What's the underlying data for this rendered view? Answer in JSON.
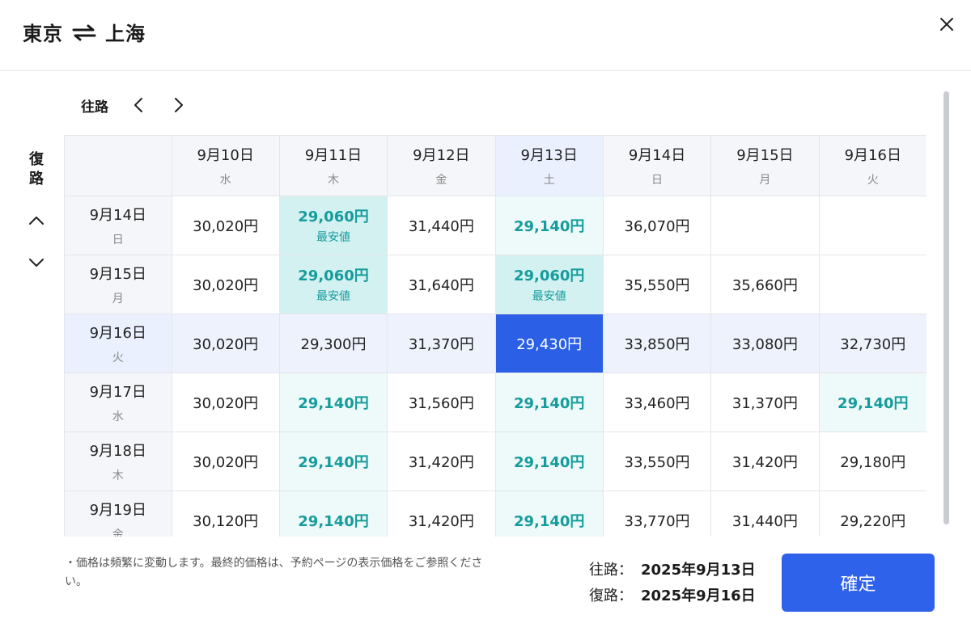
{
  "header": {
    "origin": "東京",
    "destination": "上海",
    "swap_icon": "swap-arrows-icon",
    "close_icon": "close-icon"
  },
  "outbound": {
    "label": "往路",
    "prev_icon": "chevron-left-icon",
    "next_icon": "chevron-right-icon"
  },
  "return": {
    "label": "復路",
    "up_icon": "chevron-up-icon",
    "down_icon": "chevron-down-icon"
  },
  "columns": [
    {
      "date": "9月10日",
      "weekday": "水"
    },
    {
      "date": "9月11日",
      "weekday": "木"
    },
    {
      "date": "9月12日",
      "weekday": "金"
    },
    {
      "date": "9月13日",
      "weekday": "土"
    },
    {
      "date": "9月14日",
      "weekday": "日"
    },
    {
      "date": "9月15日",
      "weekday": "月"
    },
    {
      "date": "9月16日",
      "weekday": "火"
    }
  ],
  "rows": [
    {
      "date": "9月14日",
      "weekday": "日",
      "cells": [
        {
          "price": "30,020円"
        },
        {
          "price": "29,060円",
          "tag": "最安値",
          "kind": "cheapest"
        },
        {
          "price": "31,440円"
        },
        {
          "price": "29,140円",
          "kind": "low"
        },
        {
          "price": "36,070円"
        },
        {
          "price": ""
        },
        {
          "price": ""
        }
      ]
    },
    {
      "date": "9月15日",
      "weekday": "月",
      "cells": [
        {
          "price": "30,020円"
        },
        {
          "price": "29,060円",
          "tag": "最安値",
          "kind": "cheapest"
        },
        {
          "price": "31,640円"
        },
        {
          "price": "29,060円",
          "tag": "最安値",
          "kind": "cheapest"
        },
        {
          "price": "35,550円"
        },
        {
          "price": "35,660円"
        },
        {
          "price": ""
        }
      ]
    },
    {
      "date": "9月16日",
      "weekday": "火",
      "cells": [
        {
          "price": "30,020円"
        },
        {
          "price": "29,300円"
        },
        {
          "price": "31,370円"
        },
        {
          "price": "29,430円",
          "kind": "selected"
        },
        {
          "price": "33,850円"
        },
        {
          "price": "33,080円"
        },
        {
          "price": "32,730円"
        }
      ]
    },
    {
      "date": "9月17日",
      "weekday": "水",
      "cells": [
        {
          "price": "30,020円"
        },
        {
          "price": "29,140円",
          "kind": "low"
        },
        {
          "price": "31,560円"
        },
        {
          "price": "29,140円",
          "kind": "low"
        },
        {
          "price": "33,460円"
        },
        {
          "price": "31,370円"
        },
        {
          "price": "29,140円",
          "kind": "low"
        }
      ]
    },
    {
      "date": "9月18日",
      "weekday": "木",
      "cells": [
        {
          "price": "30,020円"
        },
        {
          "price": "29,140円",
          "kind": "low"
        },
        {
          "price": "31,420円"
        },
        {
          "price": "29,140円",
          "kind": "low"
        },
        {
          "price": "33,550円"
        },
        {
          "price": "31,420円"
        },
        {
          "price": "29,180円"
        }
      ]
    },
    {
      "date": "9月19日",
      "weekday": "金",
      "cells": [
        {
          "price": "30,120円"
        },
        {
          "price": "29,140円",
          "kind": "low"
        },
        {
          "price": "31,420円"
        },
        {
          "price": "29,140円",
          "kind": "low"
        },
        {
          "price": "33,770円"
        },
        {
          "price": "31,440円"
        },
        {
          "price": "29,220円"
        }
      ]
    }
  ],
  "selection": {
    "outbound_index": 3,
    "return_index": 2
  },
  "footer": {
    "note": "・価格は頻繁に変動します。最終的価格は、予約ページの表示価格をご参照ください。",
    "outbound_label": "往路：",
    "outbound_value": "2025年9月13日",
    "return_label": "復路：",
    "return_value": "2025年9月16日",
    "confirm_label": "確定"
  },
  "colors": {
    "accent": "#2f62ea",
    "low_price": "#159c9c",
    "cheapest_bg": "#d4f1f1",
    "low_bg": "#eef9f9"
  }
}
